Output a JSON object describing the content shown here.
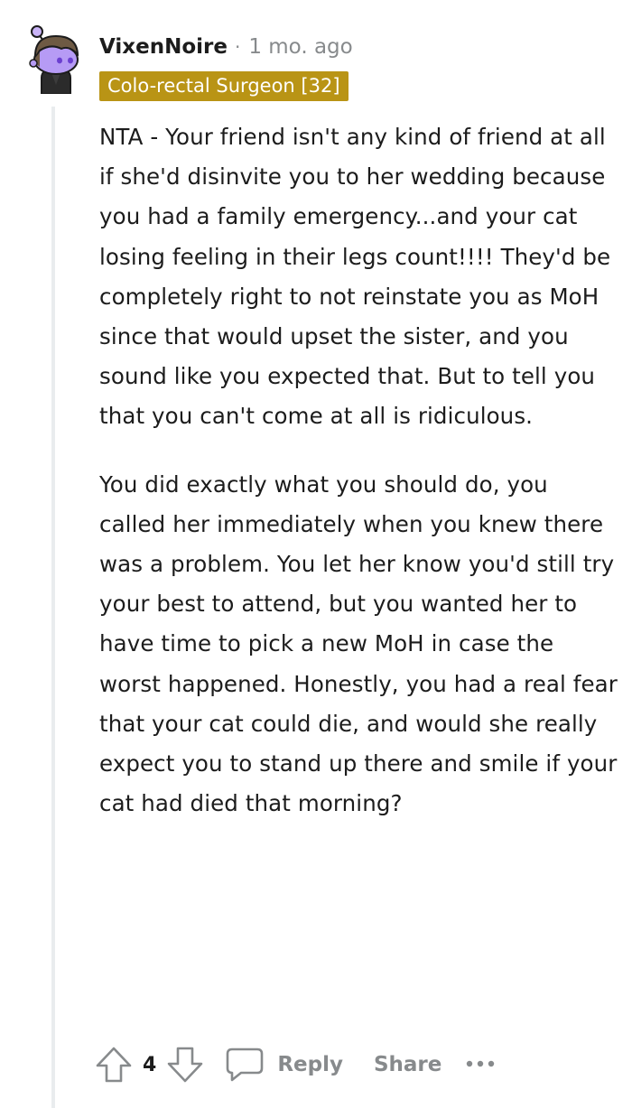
{
  "comment": {
    "author": "VixenNoire",
    "separator": "·",
    "timestamp": "1 mo. ago",
    "flair": "Colo-rectal Surgeon [32]",
    "flair_color": "#b99415",
    "avatar": "snoo-avatar",
    "paragraphs": [
      "NTA - Your friend isn't any kind of friend at all if she'd disinvite you to her wedding because you had a family emergency...and your cat losing feeling in their legs count!!!! They'd be completely right to not reinstate you as MoH since that would upset the sister, and you sound like you expected that. But to tell you that you can't come at all is ridiculous.",
      "You did exactly what you should do, you called her immediately when you knew there was a problem. You let her know you'd still try your best to attend, but you wanted her to have time to pick a new MoH in case the worst happened. Honestly, you had a real fear that your cat could die, and would she really expect you to stand up there and smile if your cat had died that morning?"
    ]
  },
  "actions": {
    "upvote_icon": "upvote-arrow-icon",
    "vote_count": "4",
    "downvote_icon": "downvote-arrow-icon",
    "reply_icon": "comment-bubble-icon",
    "reply_label": "Reply",
    "share_label": "Share",
    "more_icon": "ellipsis-icon"
  },
  "colors": {
    "text": "#1c1c1c",
    "meta": "#878a8c",
    "thread_line": "#e9ecee",
    "avatar_skin": "#b69bf5",
    "avatar_hair": "#6e5a44"
  }
}
